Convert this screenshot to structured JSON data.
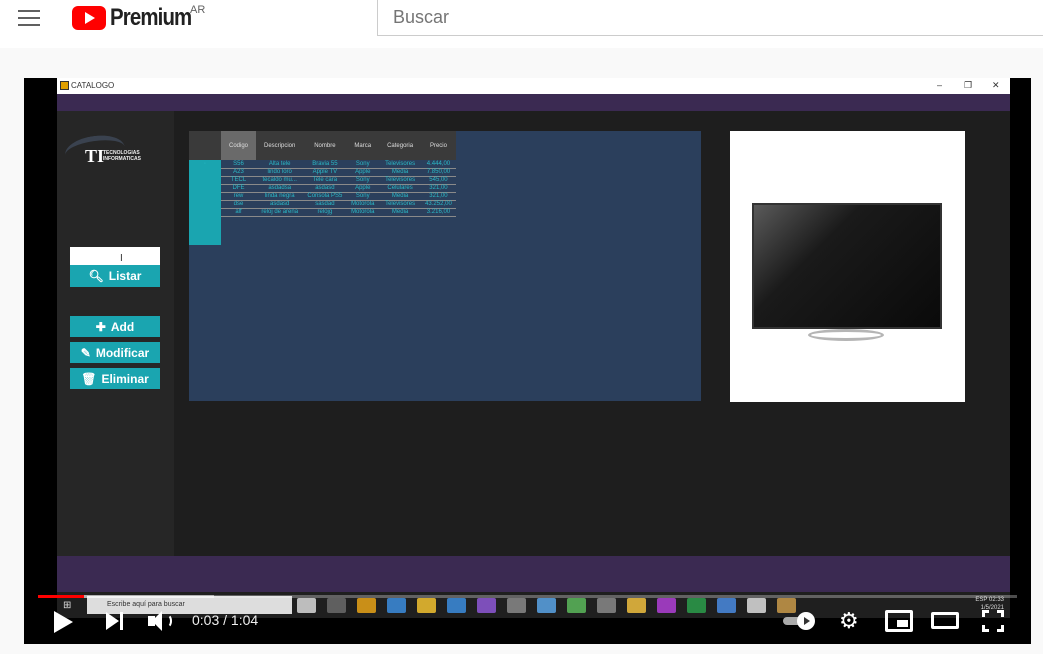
{
  "youtube": {
    "logo_text": "Premium",
    "country_code": "AR",
    "search_placeholder": "Buscar",
    "player": {
      "current_time": "0:03 / 1:04",
      "progress_fraction": 0.047,
      "buffered_fraction": 0.18
    }
  },
  "app": {
    "window_title": "CATALOGO",
    "window_controls": [
      "–",
      "❐",
      "✕"
    ],
    "logo_main": "TI",
    "logo_line1": "TECNOLOGIAS",
    "logo_line2": "INFORMATICAS",
    "search_value": "",
    "buttons": {
      "list": "Listar",
      "add": "Add",
      "modify": "Modificar",
      "delete": "Eliminar"
    },
    "table": {
      "columns": [
        "Codigo",
        "Descripcion",
        "Nombre",
        "Marca",
        "Categoria",
        "Precio"
      ],
      "rows": [
        [
          "S56",
          "Alta tele",
          "Bravia 55",
          "Sony",
          "Televisores",
          "4.444,00"
        ],
        [
          "A23",
          "lindo loro",
          "Apple TV",
          "Apple",
          "Media",
          "7.850,00"
        ],
        [
          "TECL",
          "tecaldo mu...",
          "Tele cara",
          "Sony",
          "Televisores",
          "545,00"
        ],
        [
          "DFE",
          "asdadsa",
          "asdasd",
          "Apple",
          "Celulares",
          "321,00"
        ],
        [
          "rew",
          "linda negra",
          "Consola PS5",
          "Sony",
          "Media",
          "321,00"
        ],
        [
          "dse",
          "asdasd",
          "sasdad",
          "Motorola",
          "Televisores",
          "43.252,00"
        ],
        [
          "alf",
          "reloj de arena",
          "relojg",
          "Motorola",
          "Media",
          "3.216,00"
        ]
      ]
    }
  },
  "windows_taskbar": {
    "search_placeholder": "Escribe aquí para buscar",
    "tray_lang": "ESP",
    "tray_time": "02:33",
    "tray_date": "1/5/2021",
    "icon_colors": [
      "#d9d9d9",
      "#6b6b6b",
      "#e8a317",
      "#3c8dde",
      "#f2c230",
      "#3c8dde",
      "#8e58d6",
      "#8a8a8a",
      "#5aa4e6",
      "#5cb85c",
      "#8a8a8a",
      "#f0c040",
      "#b03fd6",
      "#2c9e4b",
      "#4a8be0",
      "#dddddd",
      "#c99a4a"
    ]
  }
}
